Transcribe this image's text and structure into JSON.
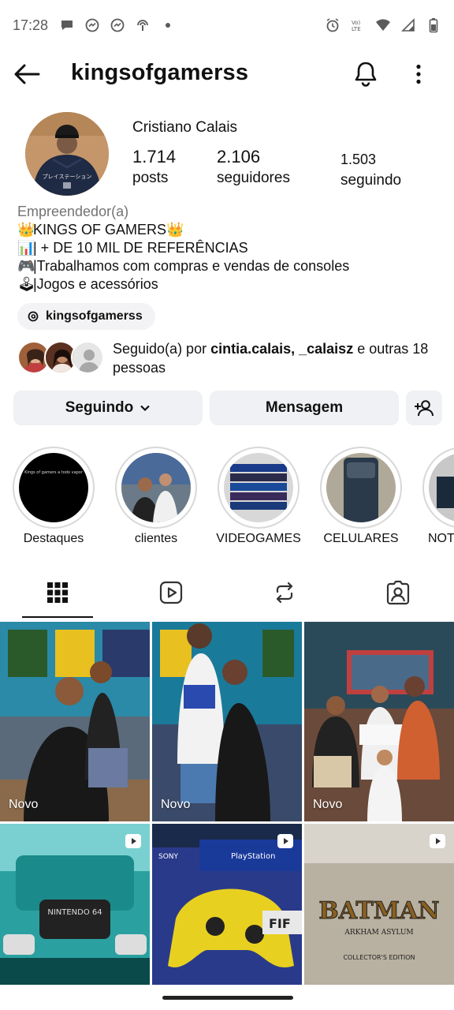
{
  "status_bar": {
    "time": "17:28"
  },
  "header": {
    "username": "kingsofgamerss"
  },
  "profile": {
    "display_name": "Cristiano Calais",
    "posts": {
      "value": "1.714",
      "label": "posts"
    },
    "followers": {
      "value": "2.106",
      "label": "seguidores"
    },
    "following": {
      "value": "1.503",
      "label": "seguindo"
    },
    "category": "Empreendedor(a)",
    "bio_lines": [
      {
        "emoji": "👑",
        "text": "KINGS OF GAMERS",
        "emoji_after": "👑"
      },
      {
        "emoji": "📊",
        "text": "| + DE 10 MIL DE REFERÊNCIAS"
      },
      {
        "emoji": "🎮",
        "text": "|Trabalhamos com compras e vendas de consoles"
      },
      {
        "emoji": "🕹",
        "text": "|Jogos e acessórios"
      }
    ],
    "threads_handle": "kingsofgamerss",
    "followed_by": {
      "prefix": "Seguido(a) por ",
      "names": "cintia.calais, _calaisz",
      "suffix": " e outras 18 pessoas"
    }
  },
  "actions": {
    "following_label": "Seguindo",
    "message_label": "Mensagem"
  },
  "highlights": [
    {
      "label": "Destaques",
      "color": "#000000"
    },
    {
      "label": "clientes",
      "color": "#8a7a6a"
    },
    {
      "label": "VIDEOGAMES",
      "color": "#2a3a6a"
    },
    {
      "label": "CELULARES",
      "color": "#3a4a5a"
    },
    {
      "label": "NOT",
      "color": "#1a2a3a"
    }
  ],
  "tabs": [
    "grid",
    "reels",
    "reposts",
    "tagged"
  ],
  "grid": [
    {
      "badge": "Novo",
      "type": "photo"
    },
    {
      "badge": "Novo",
      "type": "photo"
    },
    {
      "badge": "Novo",
      "type": "photo"
    },
    {
      "badge": "",
      "type": "reel"
    },
    {
      "badge": "",
      "type": "reel"
    },
    {
      "badge": "",
      "type": "reel"
    }
  ],
  "colors": {
    "button_bg": "#eff1f4",
    "secondary_text": "#737373",
    "text": "#111111"
  }
}
